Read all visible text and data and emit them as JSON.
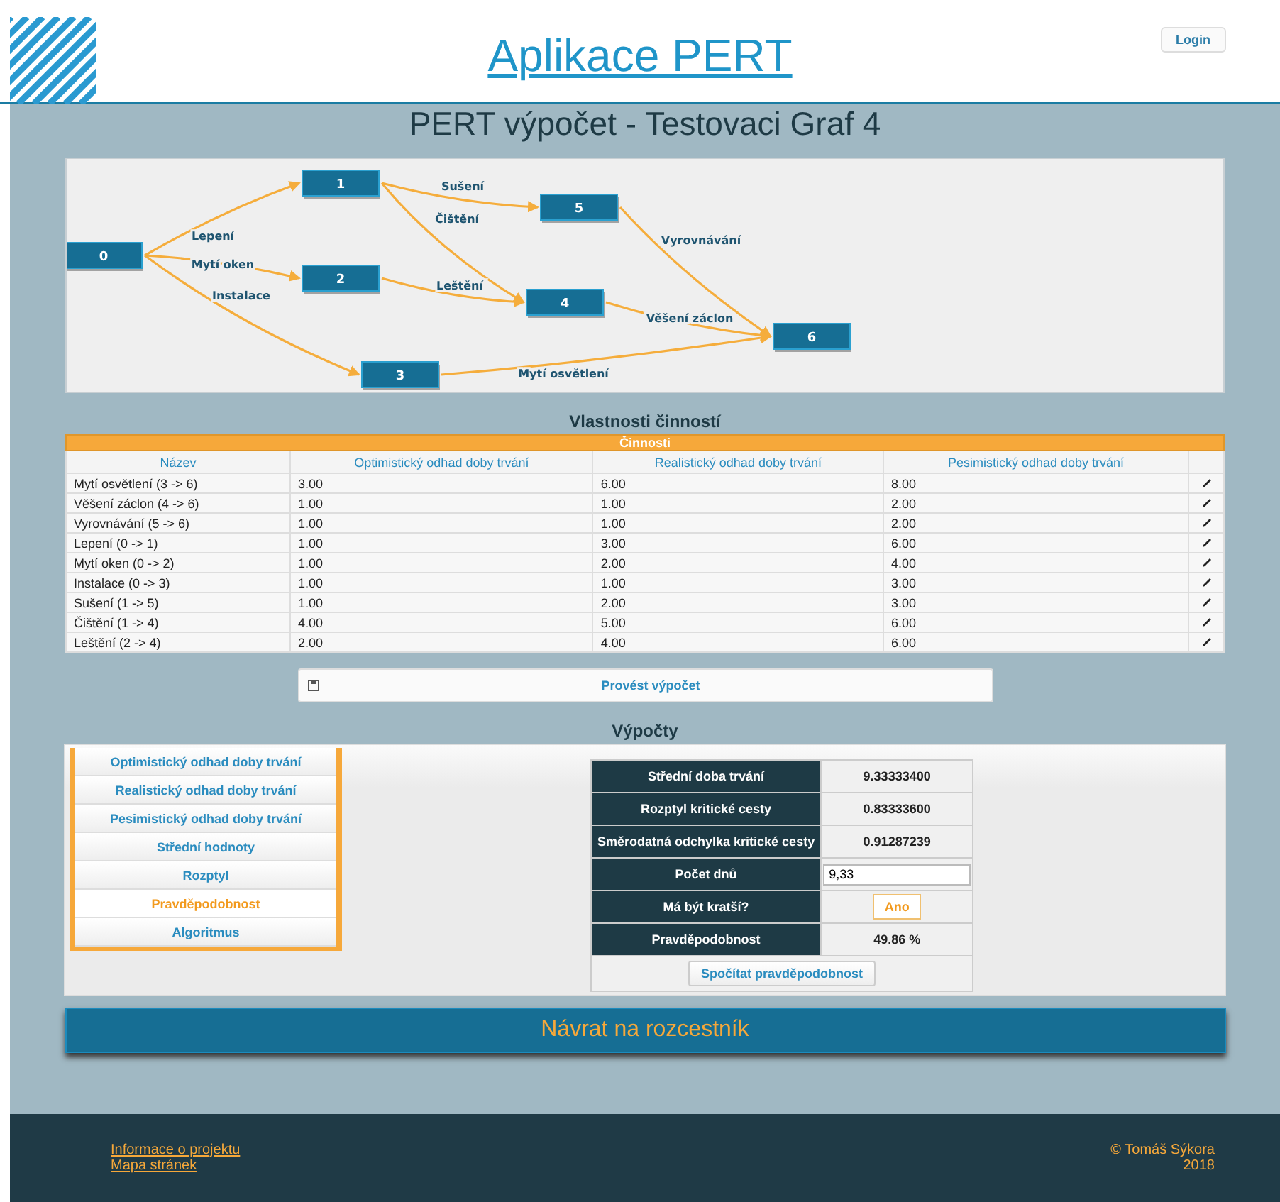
{
  "header": {
    "title": "Aplikace PERT",
    "login": "Login"
  },
  "subtitle": "PERT výpočet - Testovaci Graf 4",
  "graph": {
    "nodes": [
      "0",
      "1",
      "2",
      "3",
      "4",
      "5",
      "6"
    ],
    "edges": [
      {
        "label": "Lepení"
      },
      {
        "label": "Mytí oken"
      },
      {
        "label": "Instalace"
      },
      {
        "label": "Sušení"
      },
      {
        "label": "Čištění"
      },
      {
        "label": "Leštění"
      },
      {
        "label": "Vyrovnávání"
      },
      {
        "label": "Věšení záclon"
      },
      {
        "label": "Mytí osvětlení"
      }
    ]
  },
  "activities": {
    "title": "Vlastnosti činností",
    "caption": "Činnosti",
    "columns": [
      "Název",
      "Optimistický odhad doby trvání",
      "Realistický odhad doby trvání",
      "Pesimistický odhad doby trvání"
    ],
    "rows": [
      [
        "Mytí osvětlení (3 -> 6)",
        "3.00",
        "6.00",
        "8.00"
      ],
      [
        "Věšení záclon (4 -> 6)",
        "1.00",
        "1.00",
        "2.00"
      ],
      [
        "Vyrovnávání (5 -> 6)",
        "1.00",
        "1.00",
        "2.00"
      ],
      [
        "Lepení (0 -> 1)",
        "1.00",
        "3.00",
        "6.00"
      ],
      [
        "Mytí oken (0 -> 2)",
        "1.00",
        "2.00",
        "4.00"
      ],
      [
        "Instalace (0 -> 3)",
        "1.00",
        "1.00",
        "3.00"
      ],
      [
        "Sušení (1 -> 5)",
        "1.00",
        "2.00",
        "3.00"
      ],
      [
        "Čištění (1 -> 4)",
        "4.00",
        "5.00",
        "6.00"
      ],
      [
        "Leštění (2 -> 4)",
        "2.00",
        "4.00",
        "6.00"
      ]
    ]
  },
  "compute_button": "Provést výpočet",
  "results": {
    "title": "Výpočty",
    "tabs": [
      {
        "label": "Optimistický odhad doby trvání",
        "selected": false
      },
      {
        "label": "Realistický odhad doby trvání",
        "selected": false
      },
      {
        "label": "Pesimistický odhad doby trvání",
        "selected": false
      },
      {
        "label": "Střední hodnoty",
        "selected": false
      },
      {
        "label": "Rozptyl",
        "selected": false
      },
      {
        "label": "Pravděpodobnost",
        "selected": true
      },
      {
        "label": "Algoritmus",
        "selected": false
      }
    ],
    "rows": [
      {
        "kind": "value",
        "label": "Střední doba trvání",
        "value": "9.33333400"
      },
      {
        "kind": "value",
        "label": "Rozptyl kritické cesty",
        "value": "0.83333600"
      },
      {
        "kind": "value",
        "label": "Směrodatná odchylka kritické cesty",
        "value": "0.91287239"
      },
      {
        "kind": "input",
        "label": "Počet dnů",
        "value": "9,33"
      },
      {
        "kind": "button",
        "label": "Má být kratší?",
        "value": "Ano"
      },
      {
        "kind": "value",
        "label": "Pravděpodobnost",
        "value": "49.86 %"
      }
    ],
    "action": "Spočítat pravděpodobnost"
  },
  "back_button": "Návrat na rozcestník",
  "footer": {
    "links": [
      "Informace o projektu",
      "Mapa stránek"
    ],
    "copyright": "© Tomáš Sýkora",
    "year": "2018"
  }
}
